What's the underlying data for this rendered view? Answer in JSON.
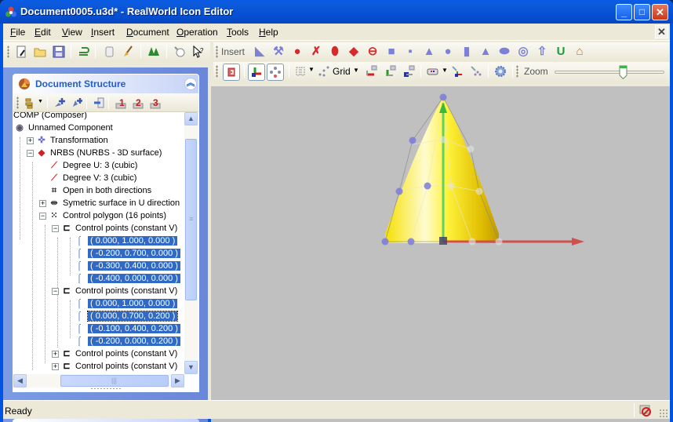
{
  "window": {
    "title": "Document0005.u3d* - RealWorld Icon Editor",
    "controls": {
      "minimize": "_",
      "maximize": "□",
      "close": "✕"
    }
  },
  "menu": [
    {
      "label": "File",
      "accel": "F"
    },
    {
      "label": "Edit",
      "accel": "E"
    },
    {
      "label": "View",
      "accel": "V"
    },
    {
      "label": "Insert",
      "accel": "I"
    },
    {
      "label": "Document",
      "accel": "D"
    },
    {
      "label": "Operation",
      "accel": "O"
    },
    {
      "label": "Tools",
      "accel": "T"
    },
    {
      "label": "Help",
      "accel": "H"
    }
  ],
  "mdi_close": "✕",
  "main_toolbar": [
    "new-document",
    "open-folder",
    "save",
    "undo",
    "copy",
    "brush",
    "trees",
    "light-bulb",
    "help-pointer"
  ],
  "insert_toolbar": {
    "label": "Insert",
    "shapes": [
      "bent-pipe",
      "hammer",
      "red-sphere-bumpy",
      "red-twist",
      "red-drop",
      "red-pyramid",
      "red-torus",
      "cube",
      "rounded-cube",
      "pyramid",
      "sphere",
      "cylinder",
      "cone",
      "capsule",
      "torus",
      "arrow",
      "u-shape",
      "house"
    ]
  },
  "view_toolbar": {
    "grid_label": "Grid",
    "zoom_label": "Zoom",
    "zoom_level": 0.62
  },
  "document_structure": {
    "title": "Document Structure",
    "tree": [
      {
        "label": "COMP (Composer)",
        "level": 0
      },
      {
        "label": "Unnamed Component",
        "level": 0
      },
      {
        "label": "Transformation",
        "level": 1
      },
      {
        "label": "NRBS (NURBS - 3D surface)",
        "level": 1
      },
      {
        "label": "Degree U: 3 (cubic)",
        "level": 2
      },
      {
        "label": "Degree V: 3 (cubic)",
        "level": 2
      },
      {
        "label": "Open in both directions",
        "level": 2
      },
      {
        "label": "Symetric surface in U direction",
        "level": 2
      },
      {
        "label": "Control polygon (16 points)",
        "level": 2
      },
      {
        "label": "Control points (constant V)",
        "level": 3
      },
      {
        "label": "( 0.000, 1.000, 0.000 )",
        "level": 4,
        "selected": true
      },
      {
        "label": "( -0.200, 0.700, 0.000 )",
        "level": 4,
        "selected": true
      },
      {
        "label": "( -0.300, 0.400, 0.000 )",
        "level": 4,
        "selected": true
      },
      {
        "label": "( -0.400, 0.000, 0.000 )",
        "level": 4,
        "selected": true
      },
      {
        "label": "Control points (constant V)",
        "level": 3
      },
      {
        "label": "( 0.000, 1.000, 0.000 )",
        "level": 4,
        "selected": true
      },
      {
        "label": "( 0.000, 0.700, 0.200 )",
        "level": 4,
        "selected": true,
        "focused": true
      },
      {
        "label": "( -0.100, 0.400, 0.200 )",
        "level": 4,
        "selected": true
      },
      {
        "label": "( -0.200, 0.000, 0.200 )",
        "level": 4,
        "selected": true
      },
      {
        "label": "Control points (constant V)",
        "level": 3
      },
      {
        "label": "Control points (constant V)",
        "level": 3
      }
    ]
  },
  "status": {
    "text": "Ready"
  },
  "colors": {
    "selection": "#316ac5",
    "viewport_bg": "#c0c0c0",
    "surface": "#ffee00",
    "axis_y": "#5fd35f",
    "axis_x": "#d05050",
    "control_point": "#7b7bdc"
  }
}
